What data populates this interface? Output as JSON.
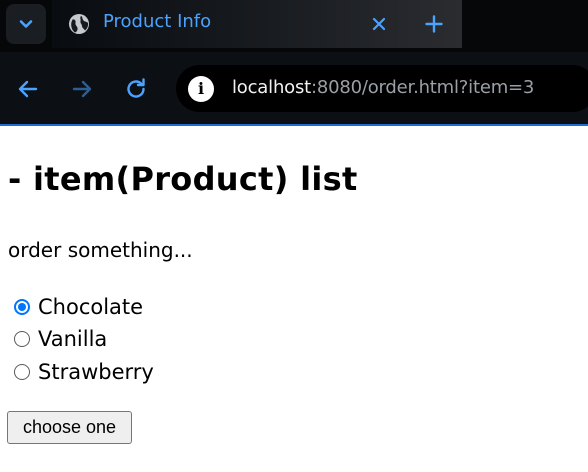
{
  "browser": {
    "tab": {
      "title": "Product Info",
      "favicon": "globe-icon"
    },
    "tab_dropdown_icon": "chevron-down-icon",
    "close_icon": "close-icon",
    "new_tab_icon": "plus-icon",
    "nav": {
      "back_icon": "arrow-left-icon",
      "forward_icon": "arrow-right-icon",
      "reload_icon": "reload-icon"
    },
    "address": {
      "info_icon": "info-icon",
      "host": "localhost",
      "rest": ":8080/order.html?item=3"
    },
    "accent_color": "#4aa3ff"
  },
  "page": {
    "heading": "- item(Product) list",
    "prompt": "order something...",
    "options": [
      {
        "label": "Chocolate",
        "checked": true
      },
      {
        "label": "Vanilla",
        "checked": false
      },
      {
        "label": "Strawberry",
        "checked": false
      }
    ],
    "button_label": "choose one"
  }
}
